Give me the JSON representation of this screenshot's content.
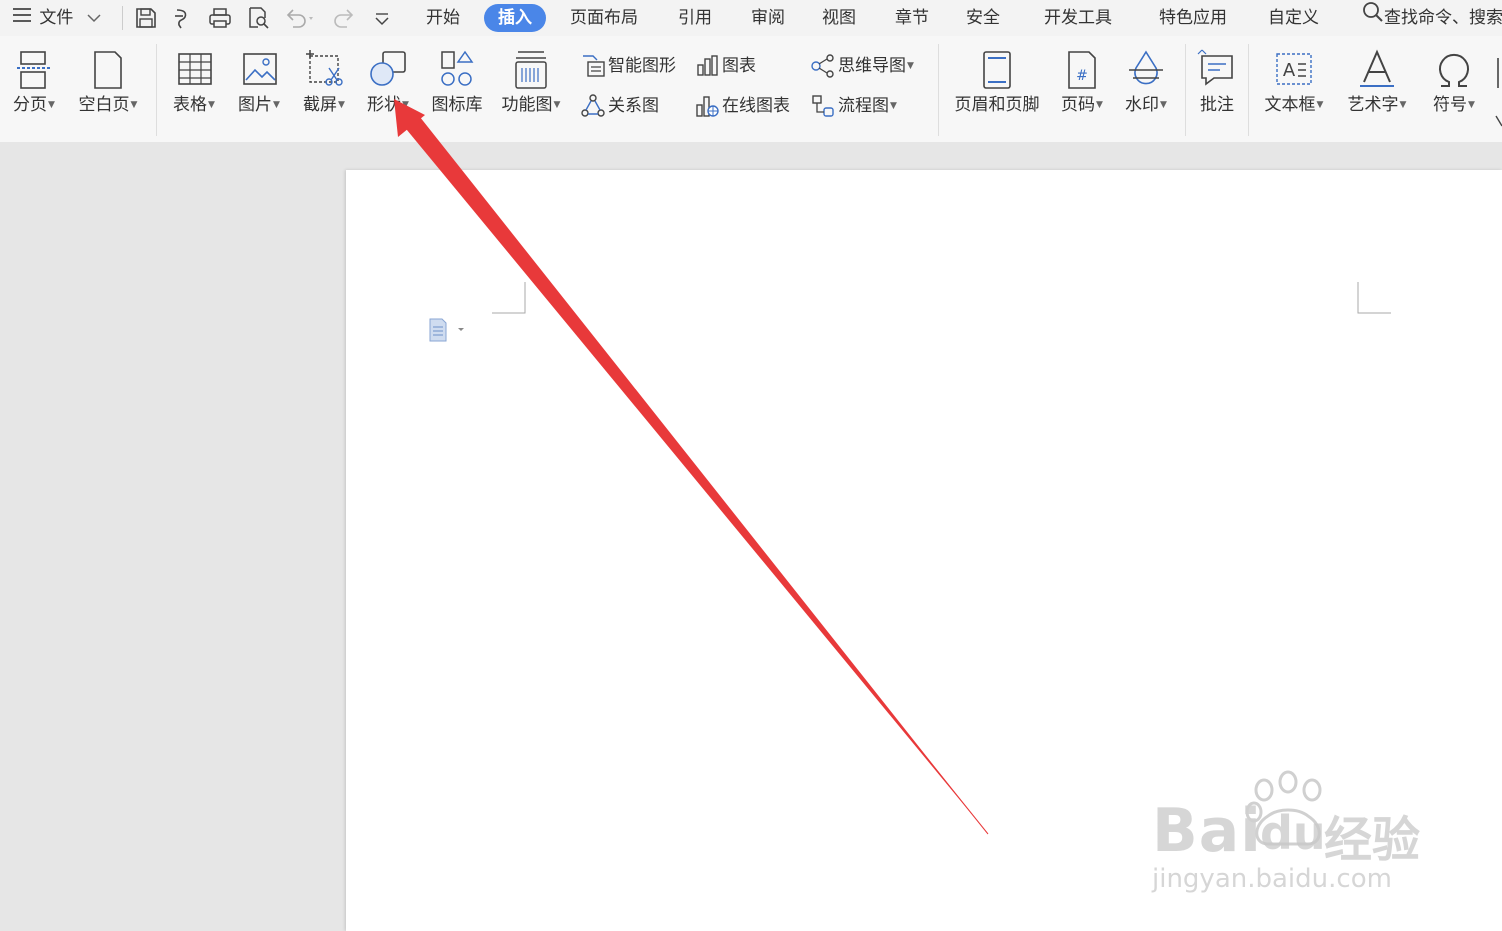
{
  "topbar": {
    "file_menu": "文件",
    "tabs": [
      {
        "label": "开始",
        "active": false
      },
      {
        "label": "插入",
        "active": true
      },
      {
        "label": "页面布局",
        "active": false
      },
      {
        "label": "引用",
        "active": false
      },
      {
        "label": "审阅",
        "active": false
      },
      {
        "label": "视图",
        "active": false
      },
      {
        "label": "章节",
        "active": false
      },
      {
        "label": "安全",
        "active": false
      },
      {
        "label": "开发工具",
        "active": false
      },
      {
        "label": "特色应用",
        "active": false
      },
      {
        "label": "自定义",
        "active": false
      }
    ],
    "search_text": "查找命令、搜索"
  },
  "ribbon": {
    "page_break": "分页",
    "blank_page": "空白页",
    "table": "表格",
    "picture": "图片",
    "screenshot": "截屏",
    "shape": "形状",
    "icon_library": "图标库",
    "function_chart": "功能图",
    "smart_art": "智能图形",
    "chart": "图表",
    "mind_map": "思维导图",
    "relation_chart": "关系图",
    "online_chart": "在线图表",
    "flow_chart": "流程图",
    "header_footer": "页眉和页脚",
    "page_number": "页码",
    "watermark": "水印",
    "comment": "批注",
    "text_box": "文本框",
    "word_art": "艺术字",
    "symbol": "符号"
  },
  "watermark": {
    "brand_main": "Bai",
    "brand_du": "du",
    "brand_cn": "经验",
    "url": "jingyan.baidu.com"
  },
  "colors": {
    "accent": "#4a86e8",
    "arrow": "#e8393a",
    "icon_blue": "#3b6fc4"
  }
}
